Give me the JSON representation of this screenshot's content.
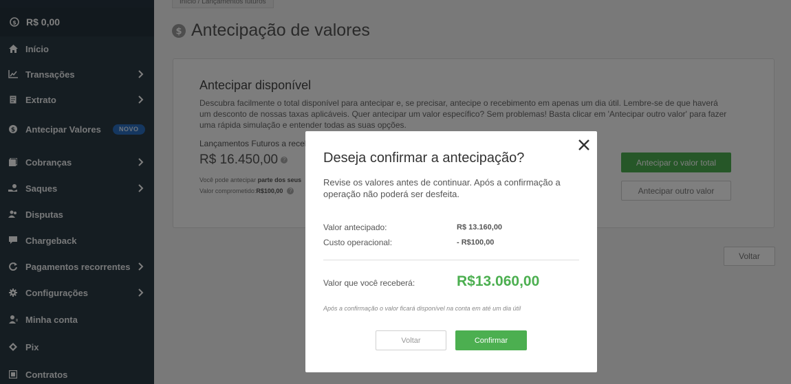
{
  "sidebar": {
    "balance": "R$ 0,00",
    "items": [
      {
        "label": "Início"
      },
      {
        "label": "Transações"
      },
      {
        "label": "Extrato"
      },
      {
        "label": "Antecipar Valores",
        "badge": "NOVO"
      },
      {
        "label": "Cobranças"
      },
      {
        "label": "Saques"
      },
      {
        "label": "Disputas"
      },
      {
        "label": "Chargeback"
      },
      {
        "label": "Pagamentos recorrentes"
      },
      {
        "label": "Configurações"
      },
      {
        "label": "Minha conta"
      },
      {
        "label": "Pix"
      },
      {
        "label": "Contratos"
      }
    ]
  },
  "breadcrumb": "Início / Lançamentos futuros",
  "page_title": "Antecipação de valores",
  "card": {
    "title": "Antecipar disponível",
    "description": "Descubra facilmente o total disponível para antecipar e, se precisar, antecipe o recebimento em apenas um dia útil. Lembre-se de que haverá um desconto de nossas taxas aplicáveis. Quer antecipar um valor específico? Sem problemas! Basta clicar em 'Antecipar outro valor' para fazer uma rápida simulação e entender todas as suas opções.",
    "future_label": "Lançamentos Futuros a recel",
    "future_amount": "R$ 16.450,00",
    "note1_prefix": "Você pode antecipar ",
    "note1_bold": "parte dos seus",
    "note2_prefix": "Valor comprometido: ",
    "note2_bold": "R$100,00",
    "btn_total": "Antecipar o valor total",
    "btn_other": "Antecipar outro valor"
  },
  "back_button": "Voltar",
  "modal": {
    "title": "Deseja confirmar a antecipação?",
    "subtitle": "Revise os valores antes de continuar. Após a confirmação a operação não poderá ser desfeita.",
    "advanced_label": "Valor antecipado:",
    "advanced_value": "R$ 13.160,00",
    "cost_label": "Custo operacional:",
    "cost_value": "- R$100,00",
    "total_label": "Valor que você receberá:",
    "total_value": "R$13.060,00",
    "note": "Após a confirmação o valor ficará disponível na conta em até um dia útil",
    "cancel": "Voltar",
    "confirm": "Confirmar"
  },
  "colors": {
    "sidebar_bg": "#2b3a44",
    "accent_green": "#4caf50",
    "badge_blue": "#2a6fc0"
  }
}
